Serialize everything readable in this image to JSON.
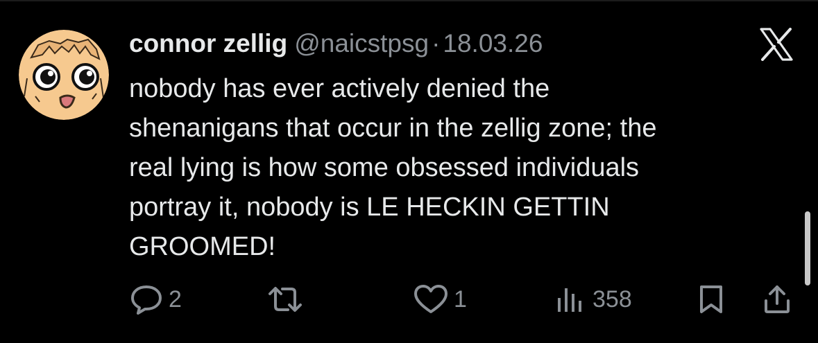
{
  "tweet": {
    "author": {
      "display_name": "connor zellig",
      "handle": "@naicstpsg",
      "avatar_icon": "cartoon-face-avatar"
    },
    "separator": "·",
    "date": "18.03.26",
    "text_lines": [
      "nobody has ever actively denied the",
      "shenanigans that occur in the zellig zone; the",
      "real lying is how some obsessed individuals",
      "portray it, nobody is LE HECKIN GETTIN",
      "GROOMED!"
    ],
    "actions": {
      "reply": {
        "icon": "reply-bubble-icon",
        "count": "2"
      },
      "retweet": {
        "icon": "retweet-icon",
        "count": ""
      },
      "like": {
        "icon": "heart-icon",
        "count": "1"
      },
      "views": {
        "icon": "views-bar-chart-icon",
        "count": "358"
      },
      "bookmark": {
        "icon": "bookmark-icon"
      },
      "share": {
        "icon": "share-upload-icon"
      }
    }
  },
  "colors": {
    "background": "#000000",
    "primary_text": "#e7e9ea",
    "secondary_text": "#8b9096",
    "avatar_skin": "#f6c98f"
  },
  "platform_logo": "x-logo-icon"
}
